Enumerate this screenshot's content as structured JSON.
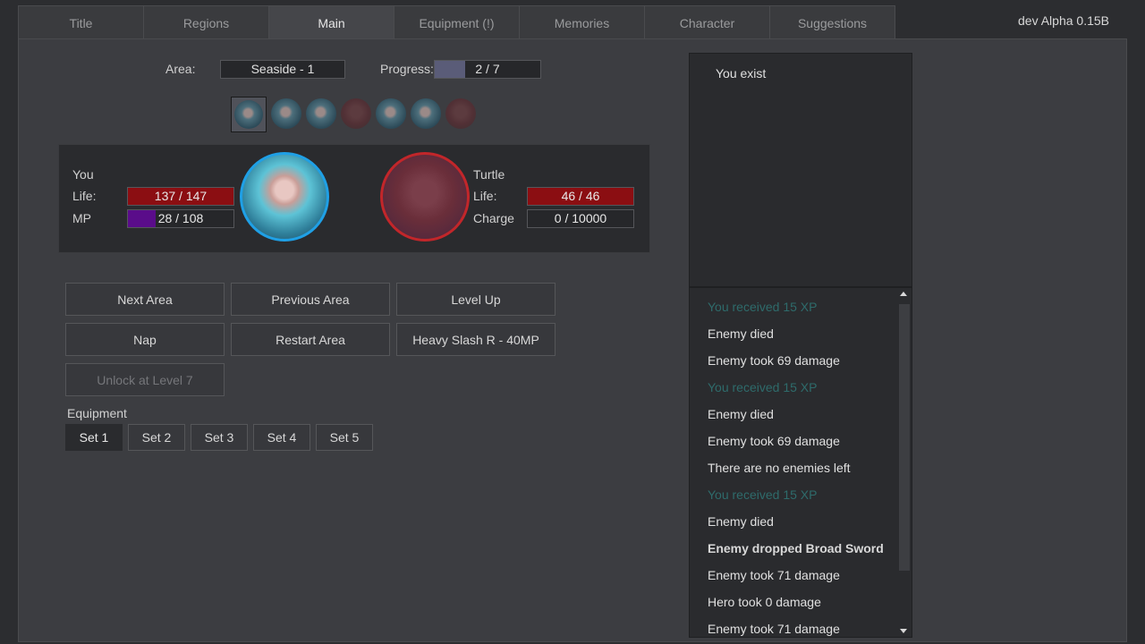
{
  "tabs": [
    {
      "label": "Title"
    },
    {
      "label": "Regions"
    },
    {
      "label": "Main",
      "active": true
    },
    {
      "label": "Equipment (!)"
    },
    {
      "label": "Memories"
    },
    {
      "label": "Character"
    },
    {
      "label": "Suggestions"
    }
  ],
  "version": "dev Alpha 0.15B",
  "area": {
    "label": "Area:",
    "value": "Seaside - 1"
  },
  "progress": {
    "label": "Progress:",
    "value": "2 / 7",
    "fraction": 0.2857
  },
  "enemy_thumbnails": [
    "face",
    "face",
    "face",
    "skull",
    "face",
    "face",
    "skull"
  ],
  "hero": {
    "name": "You",
    "life_label": "Life:",
    "life": "137 / 147",
    "life_fraction": 1.0,
    "mp_label": "MP",
    "mp": "28 / 108",
    "mp_fraction": 0.26,
    "life_color": "#8b0e12",
    "mp_color": "#5a0c8a"
  },
  "enemy": {
    "name": "Turtle",
    "life_label": "Life:",
    "life": "46 / 46",
    "life_fraction": 1.0,
    "charge_label": "Charge",
    "charge": "0 / 10000",
    "charge_fraction": 0.0,
    "life_color": "#8b0e12"
  },
  "actions": [
    {
      "label": "Next Area",
      "enabled": true
    },
    {
      "label": "Previous Area",
      "enabled": true
    },
    {
      "label": "Level Up",
      "enabled": true
    },
    {
      "label": "Nap",
      "enabled": true
    },
    {
      "label": "Restart Area",
      "enabled": true
    },
    {
      "label": "Heavy Slash R - 40MP",
      "enabled": true
    },
    {
      "label": "Unlock at Level 7",
      "enabled": false
    }
  ],
  "equipment": {
    "label": "Equipment",
    "sets": [
      {
        "label": "Set 1",
        "active": true
      },
      {
        "label": "Set 2"
      },
      {
        "label": "Set 3"
      },
      {
        "label": "Set 4"
      },
      {
        "label": "Set 5"
      }
    ]
  },
  "status": {
    "text": "You exist"
  },
  "log": [
    {
      "text": "You received 15 XP",
      "style": "xp"
    },
    {
      "text": "Enemy died",
      "style": "normal"
    },
    {
      "text": "Enemy took 69 damage",
      "style": "normal"
    },
    {
      "text": "You received 15 XP",
      "style": "xp"
    },
    {
      "text": "Enemy died",
      "style": "normal"
    },
    {
      "text": "Enemy took 69 damage",
      "style": "normal"
    },
    {
      "text": "There are no enemies left",
      "style": "normal"
    },
    {
      "text": "You received 15 XP",
      "style": "xp"
    },
    {
      "text": "Enemy died",
      "style": "normal"
    },
    {
      "text": "Enemy dropped Broad Sword",
      "style": "bold"
    },
    {
      "text": "Enemy took 71 damage",
      "style": "normal"
    },
    {
      "text": "Hero took 0 damage",
      "style": "normal"
    },
    {
      "text": "Enemy took 71 damage",
      "style": "normal"
    }
  ]
}
